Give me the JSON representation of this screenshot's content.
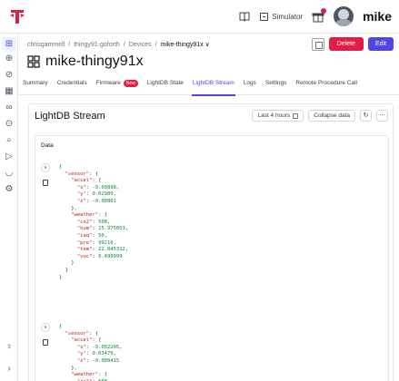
{
  "topbar": {
    "docs_icon": "book-icon",
    "simulator_label": "Simulator",
    "user_name": "mike"
  },
  "sidebar": {
    "items": [
      "grid-icon",
      "devices-icon",
      "tag-icon",
      "fleet-icon",
      "routes-icon",
      "compass-icon",
      "search-icon",
      "send-icon",
      "shield-icon",
      "settings-icon",
      "lightbulb-icon",
      "expand-icon"
    ]
  },
  "breadcrumb": {
    "org": "chrisgammell",
    "project": "thingy91-goforth",
    "section": "Devices",
    "current": "mike-thingy91x ∨"
  },
  "actions": {
    "delete_label": "Delete",
    "edit_label": "Edit"
  },
  "device": {
    "title": "mike-thingy91x"
  },
  "tabs": [
    {
      "label": "Summary"
    },
    {
      "label": "Credentials"
    },
    {
      "label": "Firmware",
      "badge": "New"
    },
    {
      "label": "LightDB State"
    },
    {
      "label": "LightDB Stream"
    },
    {
      "label": "Logs"
    },
    {
      "label": "Settings"
    },
    {
      "label": "Remote Procedure Call"
    }
  ],
  "stream": {
    "title": "LightDB Stream",
    "range_label": "Last 4 hours",
    "collapse_label": "Collapse data",
    "data_header": "Data"
  },
  "entries": [
    {
      "lines": [
        "{",
        "  \"sensor\": {",
        "    \"accel\": {",
        "      \"x\": -0.00898,",
        "      \"y\": 0.02989,",
        "      \"z\": -0.00801",
        "    },",
        "    \"weather\": {",
        "      \"co2\": 508,",
        "      \"hum\": 25.975053,",
        "      \"iaq\": 50,",
        "      \"pre\": 99210,",
        "      \"tem\": 22.845312,",
        "      \"voc\": 0.499999",
        "    }",
        "  }",
        "}"
      ]
    },
    {
      "lines": [
        "{",
        "  \"sensor\": {",
        "    \"accel\": {",
        "      \"x\": -0.002205,",
        "      \"y\": 0.03479,",
        "      \"z\": -0.008415",
        "    },",
        "    \"weather\": {",
        "      \"co2\": 508,"
      ]
    }
  ]
}
